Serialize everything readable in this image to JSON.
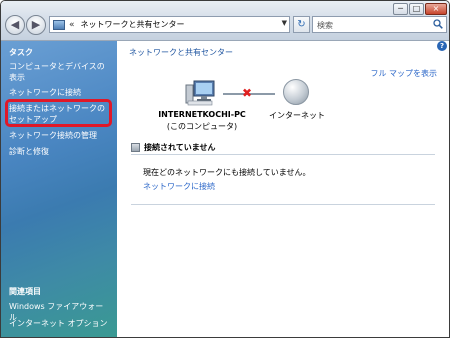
{
  "window": {
    "address_path": "ネットワークと共有センター",
    "address_chevrons": "«",
    "search_placeholder": "検索",
    "minimize": "─",
    "maximize": "□",
    "close": "×"
  },
  "sidebar": {
    "tasks_heading": "タスク",
    "tasks": [
      "コンピュータとデバイスの表示",
      "ネットワークに接続",
      "接続またはネットワークのセットアップ",
      "ネットワーク接続の管理",
      "診断と修復"
    ],
    "related_heading": "関連項目",
    "related": [
      "Windows ファイアウォール",
      "インターネット オプション"
    ]
  },
  "main": {
    "title": "ネットワークと共有センター",
    "full_map_link": "フル マップを表示",
    "computer_name": "INTERNETKOCHI-PC",
    "computer_sub": "(このコンピュータ)",
    "network_label": "インターネット",
    "disconnect_mark": "✖",
    "status": "接続されていません",
    "message": "現在どのネットワークにも接続していません。",
    "connect_link": "ネットワークに接続"
  },
  "colors": {
    "highlight": "#e01828",
    "link": "#2a66c8"
  }
}
